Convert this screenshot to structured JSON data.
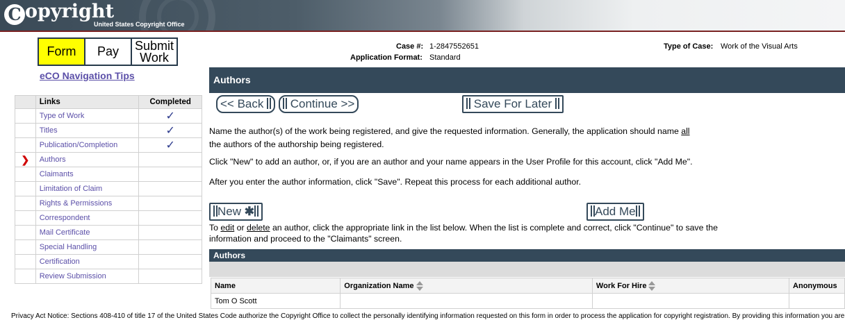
{
  "header": {
    "logo_initial": "C",
    "logo_word": "opyright",
    "logo_subtitle": "United States Copyright Office"
  },
  "steps": {
    "form": "Form",
    "pay": "Pay",
    "submit": "Submit Work"
  },
  "nav_tips_link": "eCO Navigation Tips",
  "nav_table": {
    "headers": {
      "links": "Links",
      "completed": "Completed"
    },
    "items": [
      {
        "label": "Type of Work",
        "completed": "✓"
      },
      {
        "label": "Titles",
        "completed": "✓"
      },
      {
        "label": "Publication/Completion",
        "completed": "✓"
      },
      {
        "label": "Authors",
        "completed": "",
        "current_marker": "❯"
      },
      {
        "label": "Claimants",
        "completed": ""
      },
      {
        "label": "Limitation of Claim",
        "completed": ""
      },
      {
        "label": "Rights & Permissions",
        "completed": ""
      },
      {
        "label": "Correspondent",
        "completed": ""
      },
      {
        "label": "Mail Certificate",
        "completed": ""
      },
      {
        "label": "Special Handling",
        "completed": ""
      },
      {
        "label": "Certification",
        "completed": ""
      },
      {
        "label": "Review Submission",
        "completed": ""
      }
    ]
  },
  "case": {
    "case_label": "Case #:",
    "case_value": "1-2847552651",
    "format_label": "Application Format:",
    "format_value": "Standard",
    "type_label": "Type of Case:",
    "type_value": "Work of the Visual Arts"
  },
  "section_title": "Authors",
  "buttons": {
    "back": "<< Back",
    "continue": "Continue >>",
    "save_later": "Save For Later",
    "new": "New",
    "add_me": "Add Me"
  },
  "instructions": {
    "p1_a": "Name the author(s) of the work being registered, and give the requested information. Generally, the application should name ",
    "p1_u": "all",
    "p1_b": "the authors of the authorship being registered.",
    "p2": "Click \"New\" to add an author, or, if you are an author and your name appears in the User Profile for this account, click \"Add Me\".",
    "p3": "After you enter the author information, click \"Save\". Repeat this process for each additional author.",
    "p4_a": "To ",
    "p4_edit": "edit",
    "p4_or": " or ",
    "p4_delete": "delete",
    "p4_b": " an author, click the appropriate link in the list below. When the list is complete and correct, click \"Continue\" to save the information and proceed to the \"Claimants\" screen."
  },
  "authors_table": {
    "title": "Authors",
    "columns": [
      "Name",
      "Organization Name",
      "Work For Hire",
      "Anonymous"
    ],
    "rows": [
      [
        "Tom O Scott",
        "",
        "",
        ""
      ]
    ]
  },
  "privacy_notice": "Privacy Act Notice: Sections 408-410 of title 17 of the United States Code authorize the Copyright Office to collect the personally identifying information requested on this form in order to process the application for copyright registration. By providing this information you are agreeing to"
}
